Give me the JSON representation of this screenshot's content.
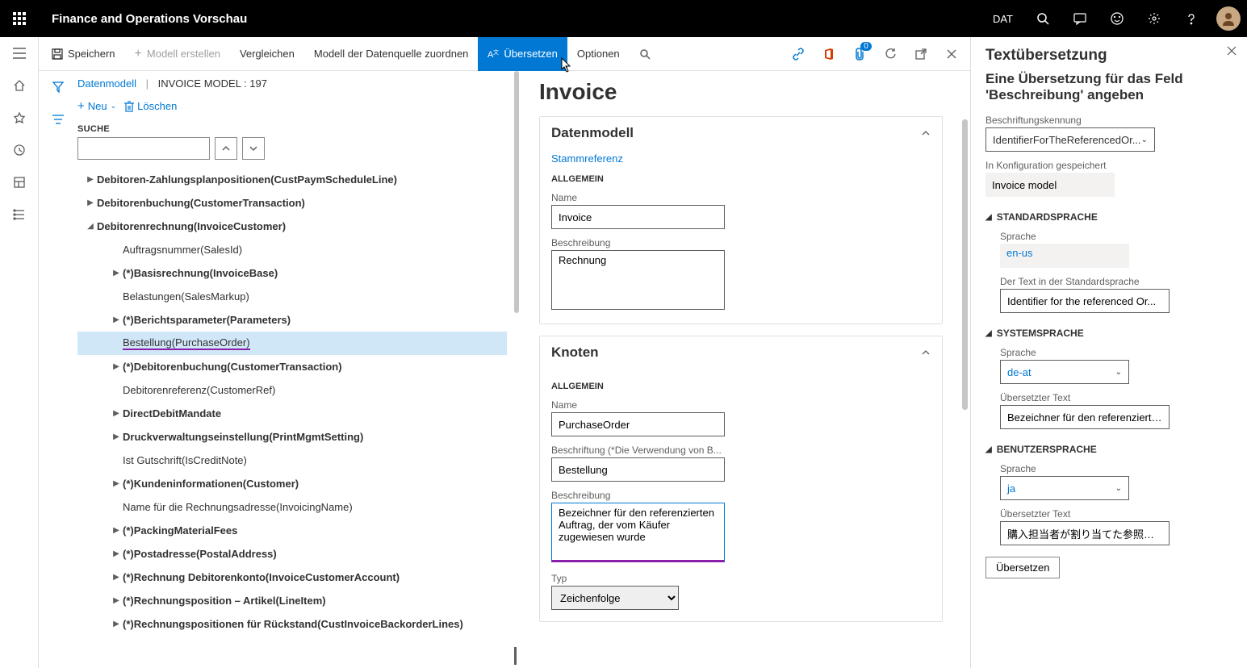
{
  "topbar": {
    "app_title": "Finance and Operations Vorschau",
    "company": "DAT"
  },
  "cmdbar": {
    "save": "Speichern",
    "create_model": "Modell erstellen",
    "compare": "Vergleichen",
    "map_datasource": "Modell der Datenquelle zuordnen",
    "translate": "Übersetzen",
    "options": "Optionen",
    "badge_count": "0"
  },
  "breadcrumb": {
    "datamodel": "Datenmodell",
    "model_name": "INVOICE MODEL : 197"
  },
  "tree": {
    "new": "Neu",
    "delete": "Löschen",
    "search_label": "SUCHE",
    "items": [
      {
        "label": "Debitoren-Zahlungsplanpositionen(CustPaymScheduleLine)",
        "indent": 1,
        "caret": "▶",
        "bold": true
      },
      {
        "label": "Debitorenbuchung(CustomerTransaction)",
        "indent": 1,
        "caret": "▶",
        "bold": true
      },
      {
        "label": "Debitorenrechnung(InvoiceCustomer)",
        "indent": 1,
        "caret": "◢",
        "bold": true
      },
      {
        "label": "Auftragsnummer(SalesId)",
        "indent": 2,
        "caret": ""
      },
      {
        "label": "(*)Basisrechnung(InvoiceBase)",
        "indent": 2,
        "caret": "▶",
        "bold": true
      },
      {
        "label": "Belastungen(SalesMarkup)",
        "indent": 2,
        "caret": ""
      },
      {
        "label": "(*)Berichtsparameter(Parameters)",
        "indent": 2,
        "caret": "▶",
        "bold": true
      },
      {
        "label": "Bestellung(PurchaseOrder)",
        "indent": 2,
        "caret": "",
        "selected": true
      },
      {
        "label": "(*)Debitorenbuchung(CustomerTransaction)",
        "indent": 2,
        "caret": "▶",
        "bold": true
      },
      {
        "label": "Debitorenreferenz(CustomerRef)",
        "indent": 2,
        "caret": ""
      },
      {
        "label": "DirectDebitMandate",
        "indent": 2,
        "caret": "▶",
        "bold": true
      },
      {
        "label": "Druckverwaltungseinstellung(PrintMgmtSetting)",
        "indent": 2,
        "caret": "▶",
        "bold": true
      },
      {
        "label": "Ist Gutschrift(IsCreditNote)",
        "indent": 2,
        "caret": ""
      },
      {
        "label": "(*)Kundeninformationen(Customer)",
        "indent": 2,
        "caret": "▶",
        "bold": true
      },
      {
        "label": "Name für die Rechnungsadresse(InvoicingName)",
        "indent": 2,
        "caret": ""
      },
      {
        "label": "(*)PackingMaterialFees",
        "indent": 2,
        "caret": "▶",
        "bold": true
      },
      {
        "label": "(*)Postadresse(PostalAddress)",
        "indent": 2,
        "caret": "▶",
        "bold": true
      },
      {
        "label": "(*)Rechnung Debitorenkonto(InvoiceCustomerAccount)",
        "indent": 2,
        "caret": "▶",
        "bold": true
      },
      {
        "label": "(*)Rechnungsposition – Artikel(LineItem)",
        "indent": 2,
        "caret": "▶",
        "bold": true
      },
      {
        "label": "(*)Rechnungspositionen für Rückstand(CustInvoiceBackorderLines)",
        "indent": 2,
        "caret": "▶",
        "bold": true
      }
    ]
  },
  "detail": {
    "page_title": "Invoice",
    "datamodel_header": "Datenmodell",
    "root_reference": "Stammreferenz",
    "allgemein": "ALLGEMEIN",
    "name_label": "Name",
    "name_value": "Invoice",
    "desc_label": "Beschreibung",
    "desc_value": "Rechnung",
    "knoten_header": "Knoten",
    "node_name": "PurchaseOrder",
    "caption_label": "Beschriftung (*Die Verwendung von B...",
    "caption_value": "Bestellung",
    "node_desc_label": "Beschreibung",
    "node_desc_value": "Bezeichner für den referenzierten Auftrag, der vom Käufer zugewiesen wurde",
    "type_label": "Typ",
    "type_value": "Zeichenfolge"
  },
  "side": {
    "title": "Textübersetzung",
    "subtitle": "Eine Übersetzung für das Feld 'Beschreibung' angeben",
    "label_id_label": "Beschriftungskennung",
    "label_id_value": "IdentifierForTheReferencedOr...",
    "saved_in_label": "In Konfiguration gespeichert",
    "saved_in_value": "Invoice model",
    "std_lang_header": "STANDARDSPRACHE",
    "lang_label": "Sprache",
    "std_lang": "en-us",
    "std_text_label": "Der Text in der Standardsprache",
    "std_text": "Identifier for the referenced Or...",
    "sys_lang_header": "SYSTEMSPRACHE",
    "sys_lang": "de-at",
    "translated_text_label": "Übersetzter Text",
    "sys_text": "Bezeichner für den referenzierte...",
    "user_lang_header": "BENUTZERSPRACHE",
    "user_lang": "ja",
    "user_text": "購入担当者が割り当てた参照オ...",
    "translate_btn": "Übersetzen"
  }
}
